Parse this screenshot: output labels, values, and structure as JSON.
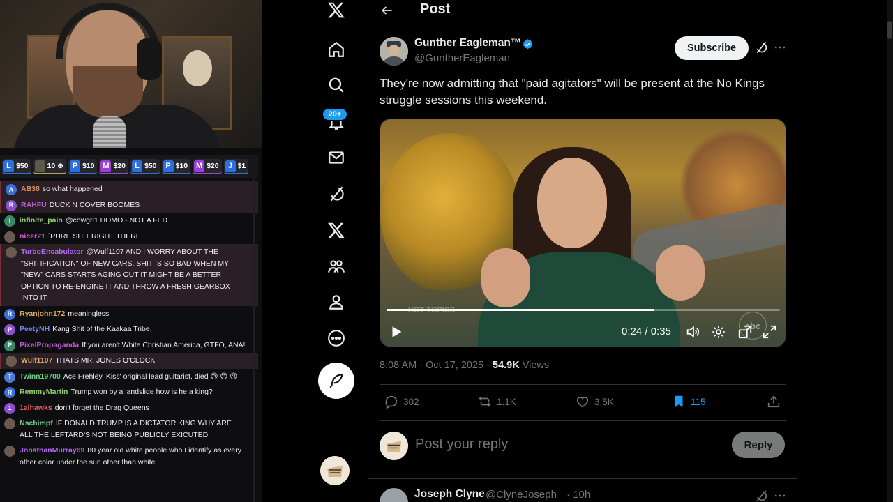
{
  "colors": {
    "x_blue": "#1d9bf0",
    "bookmark_active": "#1d9bf0",
    "chat_bg": "#0e0e10"
  },
  "stream": {
    "donations": [
      {
        "letter": "L",
        "amount": "$50",
        "color": "#2f6fdd"
      },
      {
        "letter": "",
        "amount": "10 ⊕",
        "color": "#b8a15a"
      },
      {
        "letter": "P",
        "amount": "$10",
        "color": "#2f6fdd"
      },
      {
        "letter": "M",
        "amount": "$20",
        "color": "#9b3fd6"
      },
      {
        "letter": "L",
        "amount": "$50",
        "color": "#2f6fdd"
      },
      {
        "letter": "P",
        "amount": "$10",
        "color": "#2f6fdd"
      },
      {
        "letter": "M",
        "amount": "$20",
        "color": "#9b3fd6"
      },
      {
        "letter": "J",
        "amount": "$1",
        "color": "#2f6fdd"
      }
    ],
    "chat": [
      {
        "avatar": "A",
        "user": "AB38",
        "user_color": "#e08b5a",
        "message": "so what happened",
        "highlight": true
      },
      {
        "avatar": "R",
        "user": "RAHFU",
        "user_color": "#c05ad8",
        "message": "DUCK N COVER BOOMES",
        "highlight": true
      },
      {
        "avatar": "I",
        "user": "infinite_pain",
        "user_color": "#8fd16a",
        "message": "@cowgrl1 HOMO - NOT A FED",
        "highlight": false
      },
      {
        "avatar": "",
        "user": "nicer21",
        "user_color": "#d85ad0",
        "message": "`PURE SHIT RIGHT THERE",
        "highlight": false
      },
      {
        "avatar": "",
        "user": "TurboEncabulator",
        "user_color": "#b06af0",
        "message": "@Wulf1107 AND I WORRY ABOUT THE \"SHITIFICATION\" OF NEW CARS. SHIT IS SO BAD WHEN MY \"NEW\" CARS STARTS AGING OUT IT MIGHT BE A BETTER OPTION TO RE-ENGINE IT AND THROW A FRESH GEARBOX INTO IT.",
        "highlight": true
      },
      {
        "avatar": "R",
        "user": "Ryanjohn172",
        "user_color": "#e0a85a",
        "message": "meaningless",
        "highlight": false
      },
      {
        "avatar": "P",
        "user": "PeetyNH",
        "user_color": "#6a8af0",
        "message": "Kang Shit of the Kaakaa Tribe.",
        "highlight": false
      },
      {
        "avatar": "P",
        "user": "PixelPropaganda",
        "user_color": "#c05ad8",
        "message": "If you aren't White Christian America, GTFO, ANA!",
        "highlight": false
      },
      {
        "avatar": "",
        "user": "Wulf1107",
        "user_color": "#e0a85a",
        "message": "THATS MR. JONES O'CLOCK",
        "highlight": true
      },
      {
        "avatar": "T",
        "user": "Twinn19700",
        "user_color": "#6ad08a",
        "message": "Ace Frehley, Kiss' original lead guitarist, died 😢 😢 😢",
        "highlight": false
      },
      {
        "avatar": "R",
        "user": "RemmyMartin",
        "user_color": "#8fd16a",
        "message": "Trump won by a landslide how is he a king?",
        "highlight": false
      },
      {
        "avatar": "1",
        "user": "1alhawks",
        "user_color": "#e05a5a",
        "message": "don't forget the Drag Queens",
        "highlight": false
      },
      {
        "avatar": "",
        "user": "Nschimpf",
        "user_color": "#6ad08a",
        "message": "IF DONALD TRUMP IS A DICTATOR KING WHY ARE ALL THE LEFTARD'S NOT BEING PUBLICLY EXICUTED",
        "highlight": false
      },
      {
        "avatar": "",
        "user": "JonathanMurray69",
        "user_color": "#b06af0",
        "message": "80 year old white people who I identify as every other color under the sun other than white",
        "highlight": false
      }
    ]
  },
  "x": {
    "notifications_badge": "20+",
    "header_title": "Post",
    "tweet": {
      "author_name": "Gunther Eagleman™",
      "author_handle": "@GuntherEagleman",
      "subscribe_label": "Subscribe",
      "text": "They're now admitting that \"paid agitators\" will be present at the No Kings struggle sessions this weekend.",
      "video": {
        "time": "0:24 / 0:35",
        "progress": 0.68,
        "watermark_left": "HOT TOPICS",
        "watermark_right": "abc"
      },
      "timestamp": "8:08 AM · Oct 17, 2025 · ",
      "views_count": "54.9K",
      "views_label": " Views",
      "replies": "302",
      "reposts": "1.1K",
      "likes": "3.5K",
      "bookmarks": "115"
    },
    "reply_placeholder": "Post your reply",
    "reply_button": "Reply",
    "next_reply": {
      "name": "Joseph Clyne",
      "handle": "@ClyneJoseph",
      "time": "· 10h"
    }
  }
}
